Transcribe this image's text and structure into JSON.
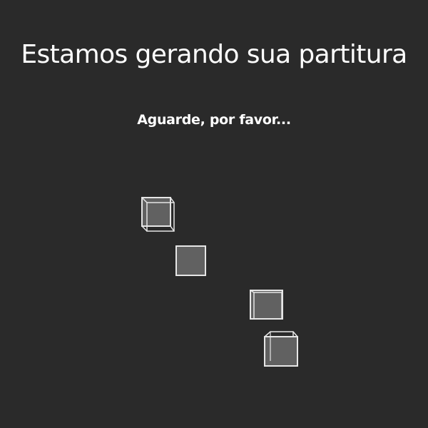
{
  "loading": {
    "title": "Estamos gerando sua partitura",
    "subtitle": "Aguarde, por favor..."
  },
  "colors": {
    "background": "#2a2a2a",
    "text": "#ffffff",
    "cube_fill": "#616161",
    "cube_stroke": "#e6e6e6"
  },
  "icons": {
    "loader": "animated-cubes-icon"
  }
}
